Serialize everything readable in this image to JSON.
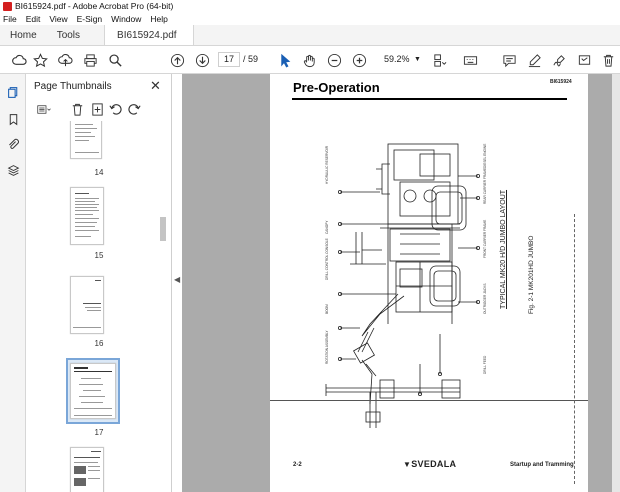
{
  "window": {
    "title": "BI615924.pdf - Adobe Acrobat Pro (64-bit)",
    "accent_color": "#d31f1f"
  },
  "menu": [
    "File",
    "Edit",
    "View",
    "E-Sign",
    "Window",
    "Help"
  ],
  "tabs": {
    "home": "Home",
    "tools": "Tools",
    "document": "BI615924.pdf"
  },
  "toolbar": {
    "current_page": "17",
    "page_separator": "/",
    "total_pages": "59",
    "zoom": "59.2%"
  },
  "thumbnails_panel": {
    "title": "Page Thumbnails",
    "close": "✕",
    "pages": [
      {
        "label": "14"
      },
      {
        "label": "15"
      },
      {
        "label": "16"
      },
      {
        "label": "17",
        "selected": true
      }
    ]
  },
  "page_content": {
    "title": "Pre-Operation",
    "doc_code": "BI615924",
    "figure_caption": "Fig. 2-1 MK201HD JUMBO",
    "layout_label": "TYPICAL MK20 H/D JUMBO LAYOUT",
    "footer_page": "2-2",
    "footer_brand": "SVEDALA",
    "footer_section": "Startup and Tramming"
  }
}
